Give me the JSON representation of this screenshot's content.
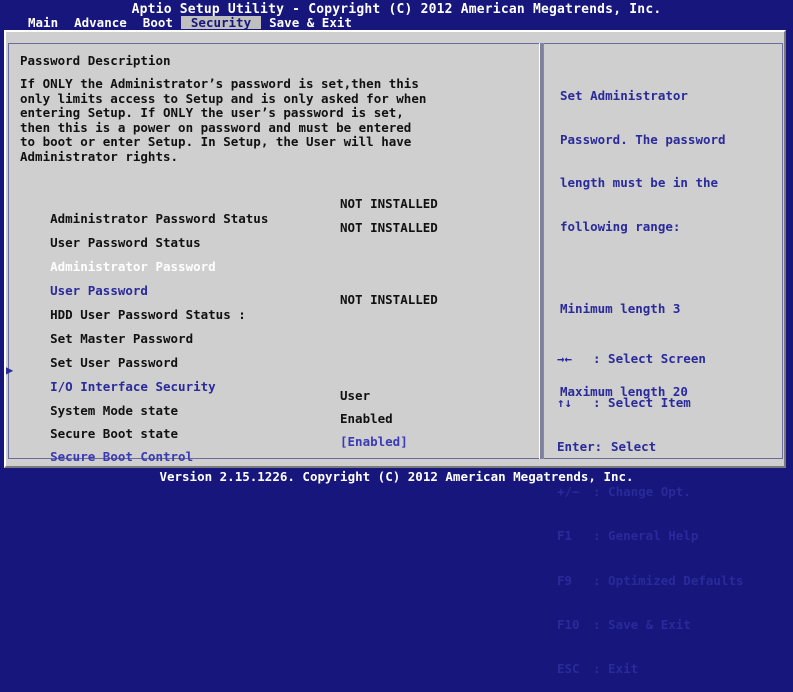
{
  "header": {
    "title": "Aptio Setup Utility - Copyright (C) 2012 American Megatrends, Inc.",
    "tabs": [
      "Main",
      "Advance",
      "Boot",
      "Security",
      "Save & Exit"
    ],
    "active_tab": "Security"
  },
  "description": {
    "title": "Password Description",
    "lines": [
      "If ONLY the Administrator’s password is set,then this",
      "only limits access to Setup and is only asked for when",
      "entering Setup. If ONLY the user’s password is set,",
      "then this is a power on password and must be entered",
      "to boot or enter Setup. In Setup, the User will have",
      "Administrator rights."
    ]
  },
  "settings": [
    {
      "label": "Administrator Password Status",
      "value": "NOT INSTALLED"
    },
    {
      "label": "User Password Status",
      "value": "NOT INSTALLED"
    },
    {
      "label": "Administrator Password",
      "value": ""
    },
    {
      "label": "User Password",
      "value": ""
    },
    {
      "label": "HDD User Password Status :",
      "value": "NOT INSTALLED"
    },
    {
      "label": "Set Master Password",
      "value": ""
    },
    {
      "label": "Set User Password",
      "value": ""
    },
    {
      "label": "I/O Interface Security",
      "value": ""
    },
    {
      "label": "System Mode state",
      "value": "User"
    },
    {
      "label": "Secure Boot state",
      "value": "Enabled"
    },
    {
      "label": "Secure Boot Control",
      "value": "[Enabled]"
    }
  ],
  "help": {
    "lines": [
      "Set Administrator",
      "Password. The password",
      "length must be in the",
      "following range:"
    ],
    "min": "Minimum length 3",
    "max": "Maximum length 20"
  },
  "keys": [
    {
      "key": "→←",
      "desc": ": Select Screen"
    },
    {
      "key": "↑↓",
      "desc": ": Select Item"
    },
    {
      "key": "Enter:",
      "desc": "Select"
    },
    {
      "key": "+/−",
      "desc": ": Change Opt."
    },
    {
      "key": "F1",
      "desc": ": General Help"
    },
    {
      "key": "F9",
      "desc": ": Optimized Defaults"
    },
    {
      "key": "F10",
      "desc": ": Save & Exit"
    },
    {
      "key": "ESC",
      "desc": ": Exit"
    }
  ],
  "footer": "Version 2.15.1226. Copyright (C) 2012 American Megatrends, Inc.",
  "colors": {
    "background": "#16167c",
    "panel": "#cfcfcf",
    "highlight_text": "#ffffff",
    "link_text": "#2a2a9a"
  }
}
